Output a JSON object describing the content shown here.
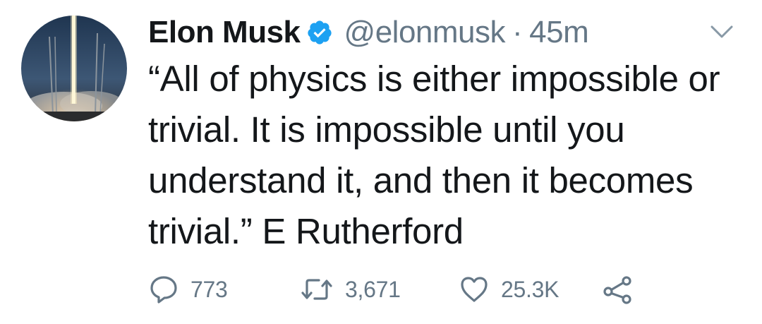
{
  "tweet": {
    "author": {
      "name": "Elon Musk",
      "verified": true,
      "handle": "@elonmusk",
      "separator": "·",
      "time": "45m",
      "avatar_icon": "rocket-launch-avatar"
    },
    "text": "“All of physics is either impossible or trivial. It is impossible until you understand it, and then it becomes trivial.” E Rutherford",
    "actions": {
      "replies": "773",
      "retweets": "3,671",
      "likes": "25.3K"
    },
    "colors": {
      "text": "#14171a",
      "secondary": "#657786",
      "verified": "#1da1f2"
    },
    "icons": {
      "verified": "verified-badge-icon",
      "menu": "chevron-down-icon",
      "reply": "reply-icon",
      "retweet": "retweet-icon",
      "like": "heart-icon",
      "share": "share-icon"
    }
  }
}
